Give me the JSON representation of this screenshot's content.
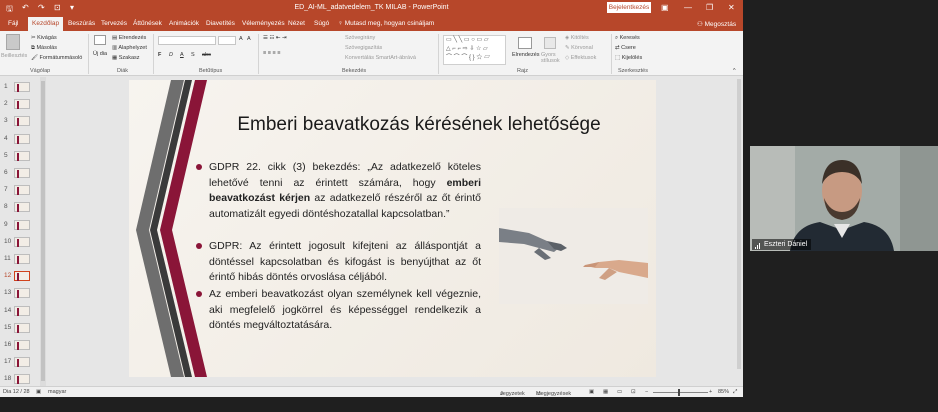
{
  "window": {
    "title": "ED_AI-ML_adatvedelem_TK MILAB  -  PowerPoint",
    "signin_label": "Bejelentkezés",
    "minimize_icon": "minimize-icon",
    "maximize_icon": "restore-icon",
    "close_icon": "close-icon"
  },
  "tabs": [
    "Fájl",
    "Kezdőlap",
    "Beszúrás",
    "Tervezés",
    "Áttűnések",
    "Animációk",
    "Diavetítés",
    "Véleményezés",
    "Nézet",
    "Súgó"
  ],
  "active_tab": "Kezdőlap",
  "tell_me": "Mutasd meg, hogyan csináljam",
  "share_label": "Megosztás",
  "ribbon": {
    "clipboard": {
      "paste": "Beillesztés",
      "cut": "Kivágás",
      "copy": "Másolás",
      "format_painter": "Formátummásoló",
      "label": "Vágólap"
    },
    "slides": {
      "new_slide": "Új dia",
      "layout": "Elrendezés",
      "reset": "Alaphelyzet",
      "section": "Szakasz",
      "label": "Diák"
    },
    "font": {
      "label": "Betűtípus",
      "buttons": [
        "F",
        "D",
        "A",
        "S",
        "abc"
      ]
    },
    "paragraph": {
      "text_direction": "Szövegirány",
      "align_text": "Szövegigazítás",
      "smartart": "Konvertálás SmartArt-ábrává",
      "label": "Bekezdés"
    },
    "drawing": {
      "arrange": "Elrendezés",
      "quick_styles": "Gyors stílusok",
      "fill": "Kitöltés",
      "outline": "Körvonal",
      "effects": "Effektusok",
      "label": "Rajz"
    },
    "editing": {
      "find": "Keresés",
      "replace": "Csere",
      "select": "Kijelölés",
      "label": "Szerkesztés"
    }
  },
  "slide_thumbnails": [
    "1",
    "2",
    "3",
    "4",
    "5",
    "6",
    "7",
    "8",
    "9",
    "10",
    "11",
    "12",
    "13",
    "14",
    "15",
    "16",
    "17",
    "18"
  ],
  "selected_slide": "12",
  "slide": {
    "title": "Emberi beavatkozás kérésének lehetősége",
    "bullet1_a": "GDPR 22. cikk (3) bekezdés: „Az adatkezelő köteles lehetővé tenni az érintett számára, hogy ",
    "bullet1_bold": "emberi beavatkozást kérjen",
    "bullet1_b": " az adatkezelő részéről az őt érintő automatizált egyedi döntéshozatallal kapcsolatban.”",
    "bullet2": "GDPR: Az érintett jogosult kifejteni az álláspontját a döntéssel kapcsolatban és kifogást is benyújthat az őt érintő hibás döntés orvoslása céljából.",
    "bullet3": "Az emberi beavatkozást olyan személynek kell végeznie, aki megfelelő jogkörrel és képességgel rendelkezik a döntés megváltoztatására."
  },
  "status": {
    "slide_counter": "Dia 12 / 28",
    "language": "magyar",
    "notes": "Jegyzetek",
    "comments": "Megjegyzések",
    "zoom": "85%"
  },
  "video": {
    "participant_name": "Eszteri Dániel"
  },
  "colors": {
    "accent": "#b7472a",
    "slide_bullet": "#8a1538"
  }
}
